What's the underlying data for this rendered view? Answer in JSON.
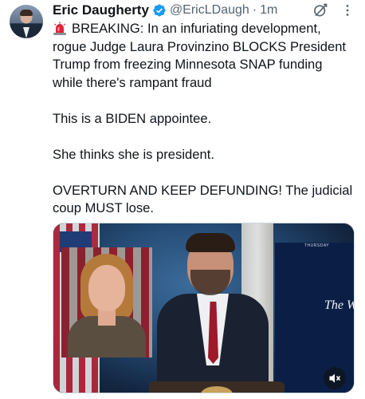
{
  "author": {
    "name": "Eric Daugherty",
    "handle": "@EricLDaugh",
    "separator": "·",
    "time": "1m",
    "verified": true,
    "verified_color": "#1d9bf0"
  },
  "tweet": {
    "paragraph_1": "BREAKING: In an infuriating development, rogue Judge Laura Provinzino BLOCKS President Trump from freezing Minnesota SNAP funding while there's rampant fraud",
    "paragraph_2": "This is a BIDEN appointee.",
    "paragraph_3": "She thinks she is president.",
    "paragraph_4": "OVERTURN AND KEEP DEFUNDING! The judicial coup MUST lose.",
    "leading_emoji": "siren-icon"
  },
  "media": {
    "screen_label": "THURSDAY",
    "screen_text": "The W",
    "mute_icon": "volume-muted-icon"
  },
  "icons": {
    "grok": "grok-icon",
    "more": "more-icon"
  },
  "colors": {
    "text": "#0f1419",
    "secondary": "#536471"
  }
}
